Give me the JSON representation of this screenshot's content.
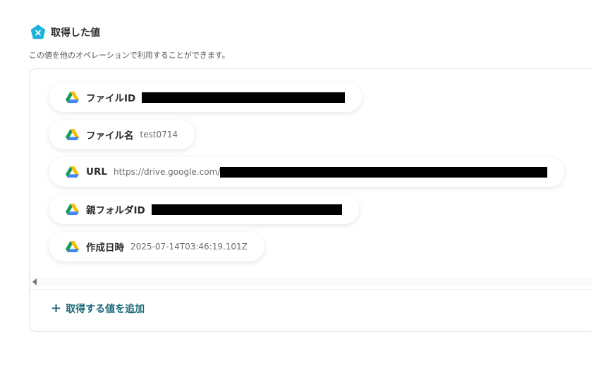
{
  "header": {
    "title": "取得した値",
    "description": "この値を他のオペレーションで利用することができます。",
    "icon": "pentagon-x-icon",
    "icon_color": "#1cb3d9"
  },
  "fields": [
    {
      "label": "ファイルID",
      "value": "",
      "icon": "google-drive-icon",
      "redacted": true
    },
    {
      "label": "ファイル名",
      "value": "test0714",
      "icon": "google-drive-icon",
      "redacted": false
    },
    {
      "label": "URL",
      "value": "https://drive.google.com/",
      "icon": "google-drive-icon",
      "redacted": true
    },
    {
      "label": "親フォルダID",
      "value": "",
      "icon": "google-drive-icon",
      "redacted": true
    },
    {
      "label": "作成日時",
      "value": "2025-07-14T03:46:19.101Z",
      "icon": "google-drive-icon",
      "redacted": false
    }
  ],
  "add_button": {
    "label": "取得する値を追加",
    "icon": "plus-icon",
    "color": "#1d6b7a"
  }
}
